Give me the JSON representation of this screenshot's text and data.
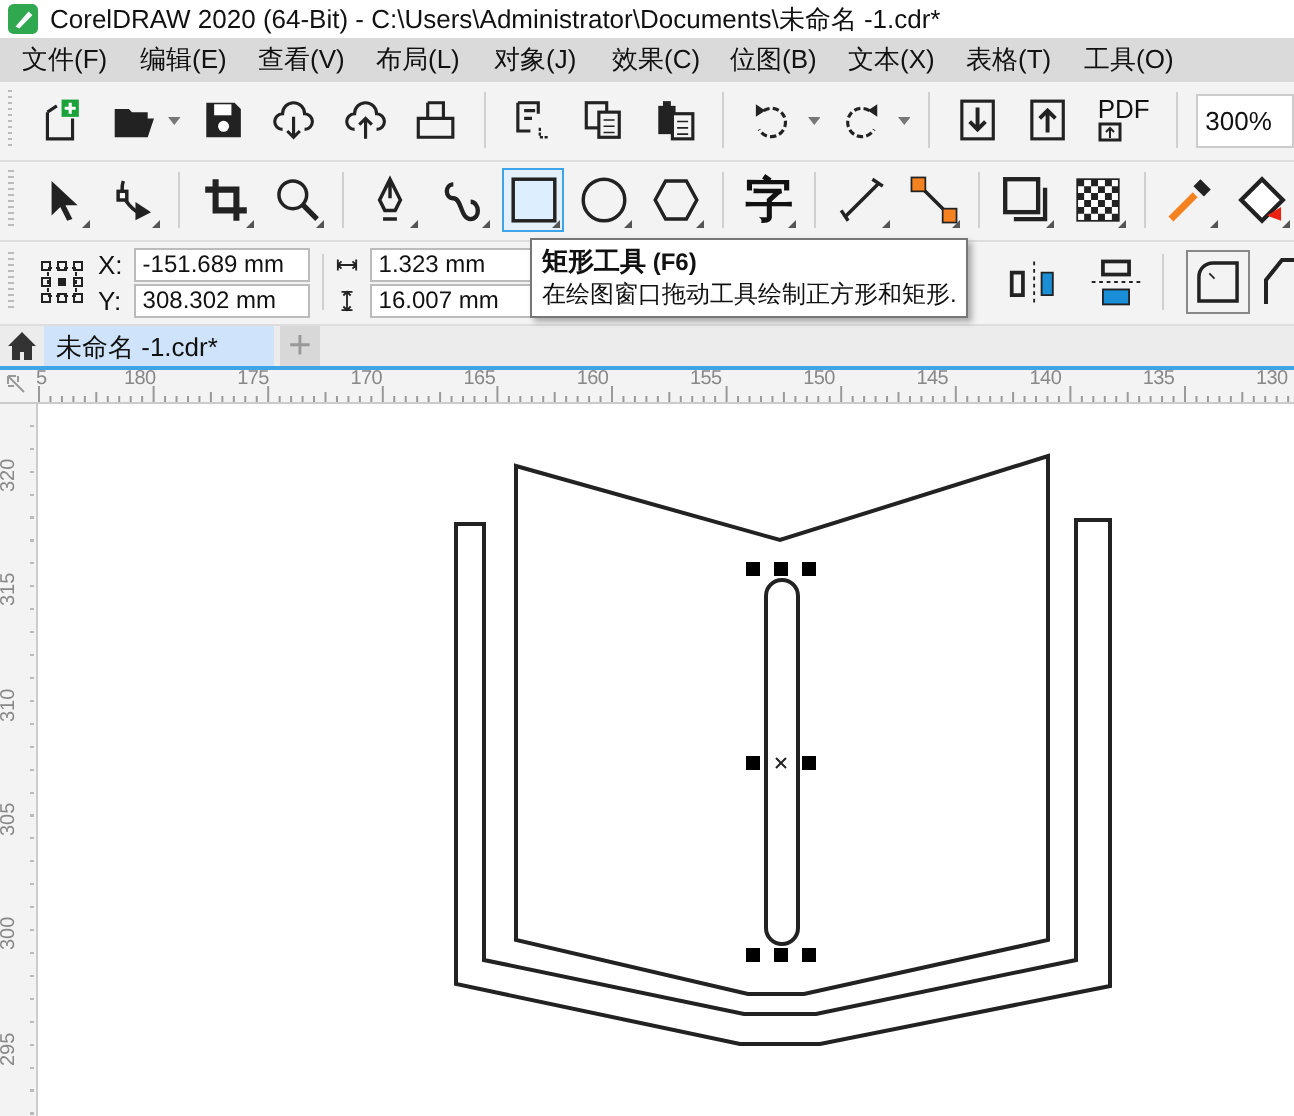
{
  "window": {
    "title": "CorelDRAW 2020 (64-Bit) - C:\\Users\\Administrator\\Documents\\未命名 -1.cdr*"
  },
  "menu": [
    "文件(F)",
    "编辑(E)",
    "查看(V)",
    "布局(L)",
    "对象(J)",
    "效果(C)",
    "位图(B)",
    "文本(X)",
    "表格(T)",
    "工具(O)"
  ],
  "standard_toolbar": {
    "pdf_label": "PDF",
    "zoom": "300%"
  },
  "toolbox": [
    {
      "selected": false
    },
    {
      "selected": false
    },
    {
      "selected": false
    },
    {
      "selected": false
    },
    {
      "selected": false
    },
    {
      "selected": false
    },
    {
      "selected": true
    },
    {
      "selected": false
    },
    {
      "selected": false
    },
    {
      "selected": false,
      "label": "字"
    },
    {
      "selected": false
    },
    {
      "selected": false
    },
    {
      "selected": false
    },
    {
      "selected": false
    },
    {
      "selected": false
    },
    {
      "selected": false
    }
  ],
  "property_bar": {
    "x_label": "X:",
    "x": "-151.689 mm",
    "y_label": "Y:",
    "y": "308.302 mm",
    "width": "1.323 mm",
    "height": "16.007 mm"
  },
  "tooltip": {
    "title": "矩形工具",
    "shortcut": "(F6)",
    "description": "在绘图窗口拖动工具绘制正方形和矩形."
  },
  "document_tabs": [
    {
      "label": "未命名 -1.cdr*",
      "selected": true
    }
  ],
  "new_tab": "+",
  "horizontal_ruler": [
    "5",
    "180",
    "175",
    "170",
    "165",
    "160",
    "155",
    "150",
    "145",
    "140",
    "135",
    "130"
  ],
  "vertical_ruler": [
    "320",
    "315",
    "310",
    "305",
    "300",
    "295"
  ]
}
